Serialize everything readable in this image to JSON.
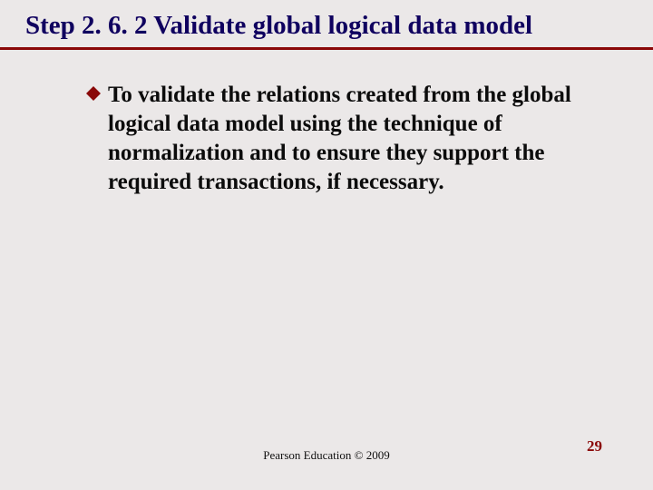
{
  "title": "Step 2. 6. 2  Validate global logical data model",
  "bullet": {
    "icon_name": "diamond-bullet-icon",
    "text": "To validate the relations created from the global logical data model using the technique of normalization and to ensure they support the required transactions, if necessary."
  },
  "footer": "Pearson Education © 2009",
  "slide_number": "29",
  "colors": {
    "title": "#0f005f",
    "rule": "#8a0808",
    "bullet_fill": "#8a0808",
    "slide_number": "#8a0808"
  }
}
